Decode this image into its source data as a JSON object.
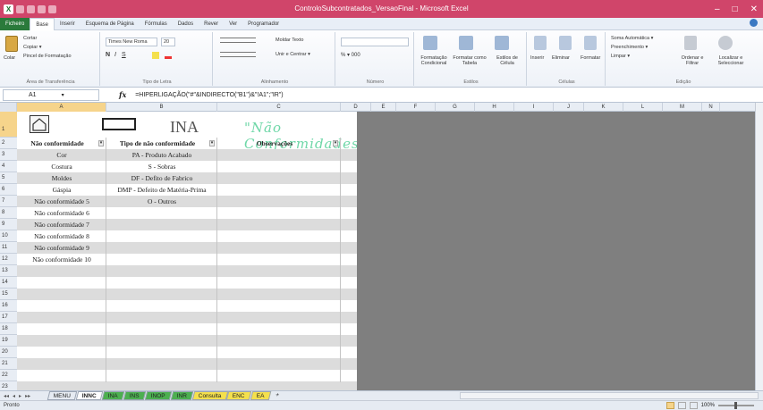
{
  "window": {
    "title_prefix": "ControloSubcontratados_VersaoFinal",
    "title_suffix": " - Microsoft Excel",
    "minimize": "–",
    "maximize": "□",
    "close": "✕"
  },
  "menu": {
    "tabs": [
      "Ficheiro",
      "Base",
      "Inserir",
      "Esquema de Página",
      "Fórmulas",
      "Dados",
      "Rever",
      "Ver",
      "Programador"
    ],
    "active_index": 1
  },
  "ribbon": {
    "clipboard": {
      "paste": "Colar",
      "cut": "Cortar",
      "copy": "Copiar ▾",
      "format_painter": "Pincel de Formatação",
      "label": "Área de Transferência"
    },
    "font": {
      "name": "Times New Roma",
      "size": "20",
      "label": "Tipo de Letra"
    },
    "alignment": {
      "wrap": "Moldar Texto",
      "merge": "Unir e Centrar ▾",
      "label": "Alinhamento"
    },
    "number": {
      "label": "Número"
    },
    "styles": {
      "conditional": "Formatação Condicional",
      "table": "Formatar como Tabela",
      "cell": "Estilos de Célula",
      "label": "Estilos"
    },
    "cells": {
      "insert": "Inserir",
      "delete": "Eliminar",
      "format": "Formatar",
      "label": "Células"
    },
    "editing": {
      "autosum": "Soma Automática ▾",
      "fill": "Preenchimento ▾",
      "clear": "Limpar ▾",
      "sort": "Ordenar e Filtrar",
      "find": "Localizar e Seleccionar",
      "label": "Edição"
    }
  },
  "formula_bar": {
    "name_box": "A1",
    "fx": "fx",
    "formula": "=HIPERLIGAÇÃO(\"#\"&INDIRECTO(\"B1\")&\"!A1\";\"IR\")"
  },
  "columns": [
    "A",
    "B",
    "C",
    "D",
    "E",
    "F",
    "G",
    "H",
    "I",
    "J",
    "K",
    "L",
    "M",
    "N"
  ],
  "rows": [
    "1",
    "2",
    "3",
    "4",
    "5",
    "6",
    "7",
    "8",
    "9",
    "10",
    "11",
    "12",
    "13",
    "14",
    "15",
    "16",
    "17",
    "18",
    "19",
    "20",
    "21",
    "22",
    "23"
  ],
  "sheet": {
    "title_code": "INA",
    "title_text": "\"Não Conformidades\"",
    "headers": [
      "Não conformidade",
      "Tipo de não conformidade",
      "Observações"
    ],
    "col_a": [
      "Cor",
      "Costura",
      "Moldes",
      "Gáspia",
      "Não conformidade 5",
      "Não conformidade 6",
      "Não conformidade 7",
      "Não conformidade 8",
      "Não conformidade 9",
      "Não conformidade 10"
    ],
    "col_b": [
      "PA - Produto Acabado",
      "S - Sobras",
      "DF - Defito de Fabrico",
      "DMP - Defeito de Matéria-Prima",
      "O - Outros"
    ]
  },
  "sheet_tabs": [
    {
      "label": "MENU",
      "color": "#e6ebf2",
      "active": false
    },
    {
      "label": "INNC",
      "color": "#ffffff",
      "active": true
    },
    {
      "label": "INA",
      "color": "#4caf50",
      "active": false
    },
    {
      "label": "INS",
      "color": "#4caf50",
      "active": false
    },
    {
      "label": "INOP",
      "color": "#4caf50",
      "active": false
    },
    {
      "label": "INR",
      "color": "#4caf50",
      "active": false
    },
    {
      "label": "Consulta",
      "color": "#f4e04d",
      "active": false
    },
    {
      "label": "ENC",
      "color": "#f4e04d",
      "active": false
    },
    {
      "label": "EA",
      "color": "#f4e04d",
      "active": false
    }
  ],
  "status": {
    "mode": "Pronto",
    "zoom": "100%"
  }
}
